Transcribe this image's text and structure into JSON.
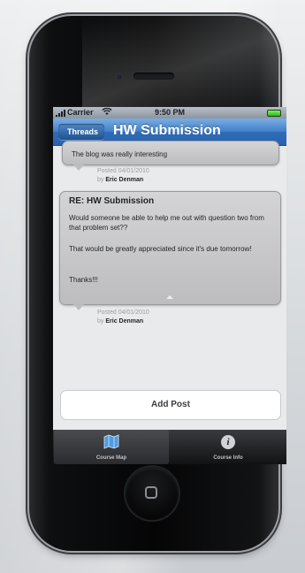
{
  "status_bar": {
    "carrier": "Carrier",
    "time": "9:50 PM"
  },
  "nav_bar": {
    "back_label": "Threads",
    "title": "HW Submission"
  },
  "posts": [
    {
      "body": "The blog was really interesting",
      "posted": "Posted 04/01/2010",
      "by_prefix": "by",
      "author": "Eric Denman"
    },
    {
      "heading": "RE: HW Submission",
      "paragraphs": [
        "Would someone be able to help me out with question two from that problem set??",
        "That would be greatly appreciated since it's due tomorrow!",
        "Thanks!!!"
      ],
      "posted": "Posted 04/01/2010",
      "by_prefix": "by",
      "author": "Eric Denman"
    }
  ],
  "add_post_label": "Add Post",
  "tabs": [
    {
      "label": "Course Map",
      "icon": "map-icon",
      "selected": true
    },
    {
      "label": "Course Info",
      "icon": "info-icon",
      "selected": false
    }
  ],
  "colors": {
    "nav_blue": "#3f7ec8",
    "bubble_grey": "#c9c9cc",
    "tab_bar": "#1a1b1d"
  }
}
